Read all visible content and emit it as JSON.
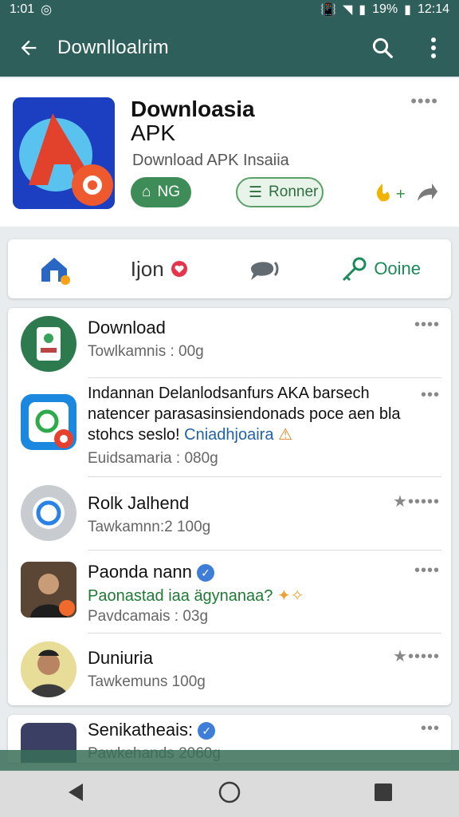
{
  "status": {
    "time_left": "1:01",
    "battery": "19%",
    "time_right": "12:14"
  },
  "appbar": {
    "title": "Downlloalrim"
  },
  "header": {
    "title_line1": "Downloasia",
    "title_line2": "APK",
    "subtitle": "Download APK Insaiia",
    "chip_installed": "NG",
    "chip_rooner": "Ronner"
  },
  "actions": {
    "item2": "Ijon",
    "item4": "Ooine"
  },
  "feed": {
    "items": [
      {
        "name": "Download",
        "meta": "Towlkamnis : 00g"
      },
      {
        "line1": "Indannan Delanlodsanfurs AKA barsech",
        "line2": "natencer parasasinsiendonads poce aen bla",
        "line3_a": "stohcs seslo!",
        "line3_b": "Cniadhjoaira",
        "meta": "Euidsamaria : 080g"
      },
      {
        "name": "Rolk Jalhend",
        "meta": "Tawkamnn:2 100g"
      },
      {
        "name": "Paonda nann",
        "body": "Paonastad iaa ägynanaa?",
        "meta": "Pavdcamais : 03g"
      },
      {
        "name": "Duniuria",
        "meta": "Tawkemuns 100g"
      }
    ]
  },
  "partial": {
    "name": "Senikatheais:",
    "meta": "Pawkehands 2060g"
  },
  "colors": {
    "appbar": "#2f5f5a",
    "green": "#3e8d58",
    "accent": "#2163a8"
  },
  "icons": [
    "back-icon",
    "search-icon",
    "more-vert-icon",
    "nav-back-icon",
    "nav-home-icon",
    "nav-recents-icon"
  ]
}
